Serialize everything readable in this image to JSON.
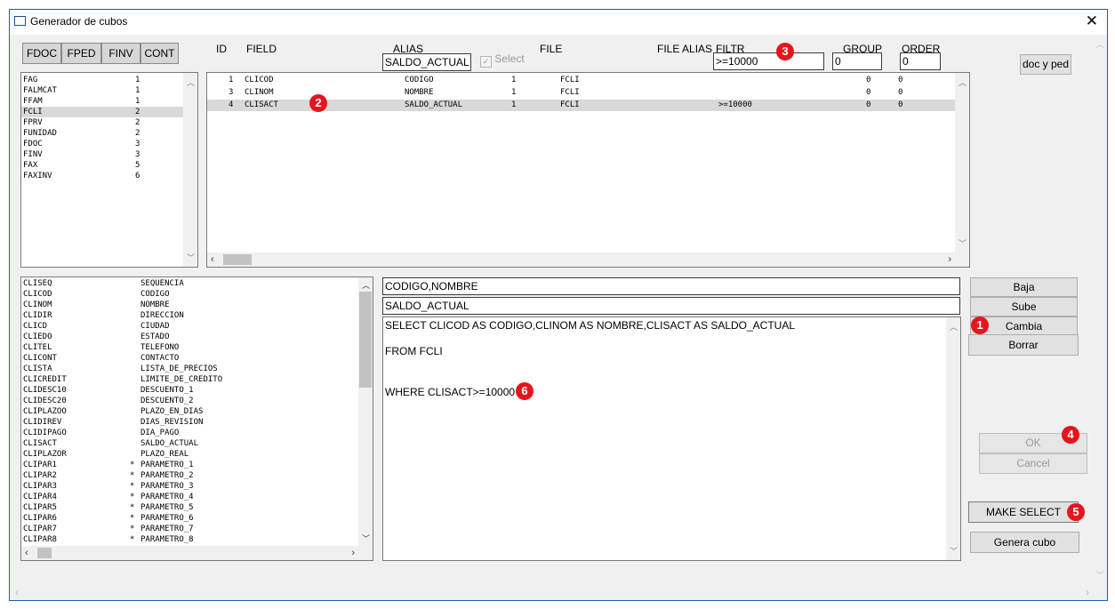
{
  "window": {
    "title": "Generador de cubos",
    "close_glyph": "✕"
  },
  "tabs": [
    "FDOC",
    "FPED",
    "FINV",
    "CONT"
  ],
  "table_list": [
    {
      "name": "FAG",
      "count": "1"
    },
    {
      "name": "FALMCAT",
      "count": "1"
    },
    {
      "name": "FFAM",
      "count": "1"
    },
    {
      "name": "FCLI",
      "count": "2"
    },
    {
      "name": "FPRV",
      "count": "2"
    },
    {
      "name": "FUNIDAD",
      "count": "2"
    },
    {
      "name": "FDOC",
      "count": "3"
    },
    {
      "name": "FINV",
      "count": "3"
    },
    {
      "name": "FAX",
      "count": "5"
    },
    {
      "name": "FAXINV",
      "count": "6"
    }
  ],
  "grid": {
    "headers": {
      "id": "ID",
      "field": "FIELD",
      "alias": "ALIAS",
      "file": "FILE",
      "file_alias": "FILE ALIAS",
      "filtr": "FILTR",
      "group": "GROUP",
      "order": "ORDER"
    },
    "editors": {
      "alias": "SALDO_ACTUAL",
      "select_label": "Select",
      "filtr": ">=10000",
      "group": "0",
      "order": "0"
    },
    "rows": [
      {
        "id": "1",
        "field": "CLICOD",
        "alias": "CODIGO",
        "sel": "1",
        "file": "FCLI",
        "filtr": "",
        "group": "0",
        "order": "0"
      },
      {
        "id": "3",
        "field": "CLINOM",
        "alias": "NOMBRE",
        "sel": "1",
        "file": "FCLI",
        "filtr": "",
        "group": "0",
        "order": "0"
      },
      {
        "id": "4",
        "field": "CLISACT",
        "alias": "SALDO_ACTUAL",
        "sel": "1",
        "file": "FCLI",
        "filtr": ">=10000",
        "group": "0",
        "order": "0"
      }
    ]
  },
  "field_list": [
    {
      "name": "CLISEQ",
      "star": "",
      "alias": "SEQUENCIA"
    },
    {
      "name": "CLICOD",
      "star": "",
      "alias": "CODIGO"
    },
    {
      "name": "CLINOM",
      "star": "",
      "alias": "NOMBRE"
    },
    {
      "name": "CLIDIR",
      "star": "",
      "alias": "DIRECCION"
    },
    {
      "name": "CLICD",
      "star": "",
      "alias": "CIUDAD"
    },
    {
      "name": "CLIEDO",
      "star": "",
      "alias": "ESTADO"
    },
    {
      "name": "CLITEL",
      "star": "",
      "alias": "TELEFONO"
    },
    {
      "name": "CLICONT",
      "star": "",
      "alias": "CONTACTO"
    },
    {
      "name": "CLISTA",
      "star": "",
      "alias": "LISTA_DE_PRECIOS"
    },
    {
      "name": "CLICREDIT",
      "star": "",
      "alias": "LIMITE_DE_CREDITO"
    },
    {
      "name": "CLIDESC10",
      "star": "",
      "alias": "DESCUENTO_1"
    },
    {
      "name": "CLIDESC20",
      "star": "",
      "alias": "DESCUENTO_2"
    },
    {
      "name": "CLIPLAZOO",
      "star": "",
      "alias": "PLAZO_EN_DIAS"
    },
    {
      "name": "CLIDIREV",
      "star": "",
      "alias": "DIAS_REVISION"
    },
    {
      "name": "CLIDIPAGO",
      "star": "",
      "alias": "DIA_PAGO"
    },
    {
      "name": "CLISACT",
      "star": "",
      "alias": "SALDO_ACTUAL"
    },
    {
      "name": "CLIPLAZOR",
      "star": "",
      "alias": "PLAZO_REAL"
    },
    {
      "name": "CLIPAR1",
      "star": "*",
      "alias": "PARAMETRO_1"
    },
    {
      "name": "CLIPAR2",
      "star": "*",
      "alias": "PARAMETRO_2"
    },
    {
      "name": "CLIPAR3",
      "star": "*",
      "alias": "PARAMETRO_3"
    },
    {
      "name": "CLIPAR4",
      "star": "*",
      "alias": "PARAMETRO_4"
    },
    {
      "name": "CLIPAR5",
      "star": "*",
      "alias": "PARAMETRO_5"
    },
    {
      "name": "CLIPAR6",
      "star": "*",
      "alias": "PARAMETRO_6"
    },
    {
      "name": "CLIPAR7",
      "star": "*",
      "alias": "PARAMETRO_7"
    },
    {
      "name": "CLIPAR8",
      "star": "*",
      "alias": "PARAMETRO_8"
    }
  ],
  "sql": {
    "dimensions": "CODIGO,NOMBRE",
    "measures": "SALDO_ACTUAL",
    "select_line": "SELECT CLICOD AS CODIGO,CLINOM AS NOMBRE,CLISACT AS SALDO_ACTUAL",
    "from_line": "FROM FCLI",
    "where_line": "WHERE CLISACT>=10000"
  },
  "buttons": {
    "doc_y_ped": "doc y ped",
    "baja": "Baja",
    "sube": "Sube",
    "cambia": "Cambia",
    "borrar": "Borrar",
    "ok": "OK",
    "cancel": "Cancel",
    "make_select": "MAKE SELECT",
    "genera_cubo": "Genera cubo"
  },
  "markers": [
    "1",
    "2",
    "3",
    "4",
    "5",
    "6"
  ],
  "colors": {
    "marker": "#e8141d",
    "selected_row": "#d9d9d9",
    "window_border": "#1b5fa8"
  }
}
